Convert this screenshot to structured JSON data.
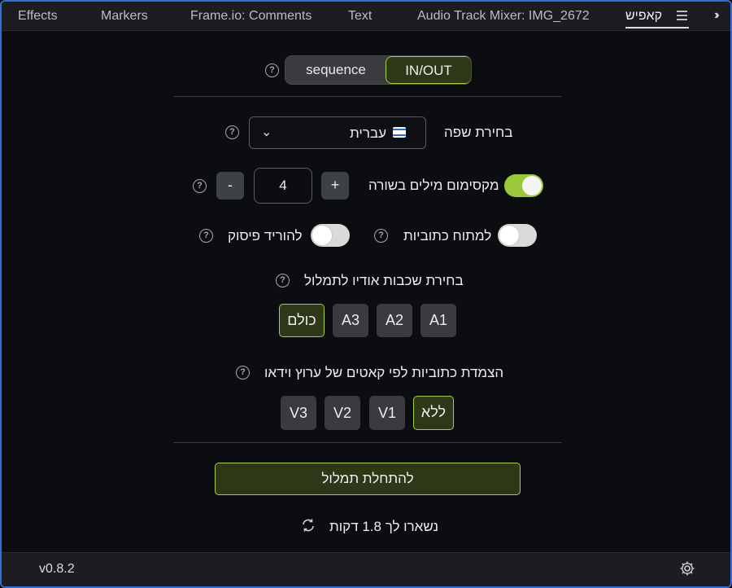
{
  "tabs": [
    {
      "label": "Effects"
    },
    {
      "label": "Markers"
    },
    {
      "label": "Frame.io: Comments"
    },
    {
      "label": "Text"
    },
    {
      "label": "Audio Track Mixer: IMG_2672"
    },
    {
      "label": "קאפיש"
    }
  ],
  "mode": {
    "left": "sequence",
    "right": "IN/OUT",
    "selected": "IN/OUT"
  },
  "language": {
    "label": "בחירת שפה",
    "value": "עברית"
  },
  "max_words": {
    "label": "מקסימום מילים בשורה",
    "value": "4",
    "minus": "-",
    "plus": "+",
    "enabled": true
  },
  "stretch": {
    "label": "למתוח כתוביות",
    "enabled": false
  },
  "punctuation": {
    "label": "להוריד פיסוק",
    "enabled": false
  },
  "audio_layers": {
    "label": "בחירת שכבות אודיו לתמלול",
    "options": [
      "A1",
      "A2",
      "A3",
      "כולם"
    ],
    "selected": "כולם"
  },
  "video_cuts": {
    "label": "הצמדת כתוביות לפי קאטים של ערוץ וידאו",
    "options": [
      "ללא",
      "V1",
      "V2",
      "V3"
    ],
    "selected": "ללא"
  },
  "start_button": "להתחלת תמלול",
  "remaining": "נשארו לך 1.8 דקות",
  "version": "v0.8.2",
  "colors": {
    "accent": "#a4d233",
    "accent_bg": "#2c3818",
    "toggle_on": "#9bc93a",
    "panel_bg": "#0c0d10"
  },
  "help_symbol": "?"
}
